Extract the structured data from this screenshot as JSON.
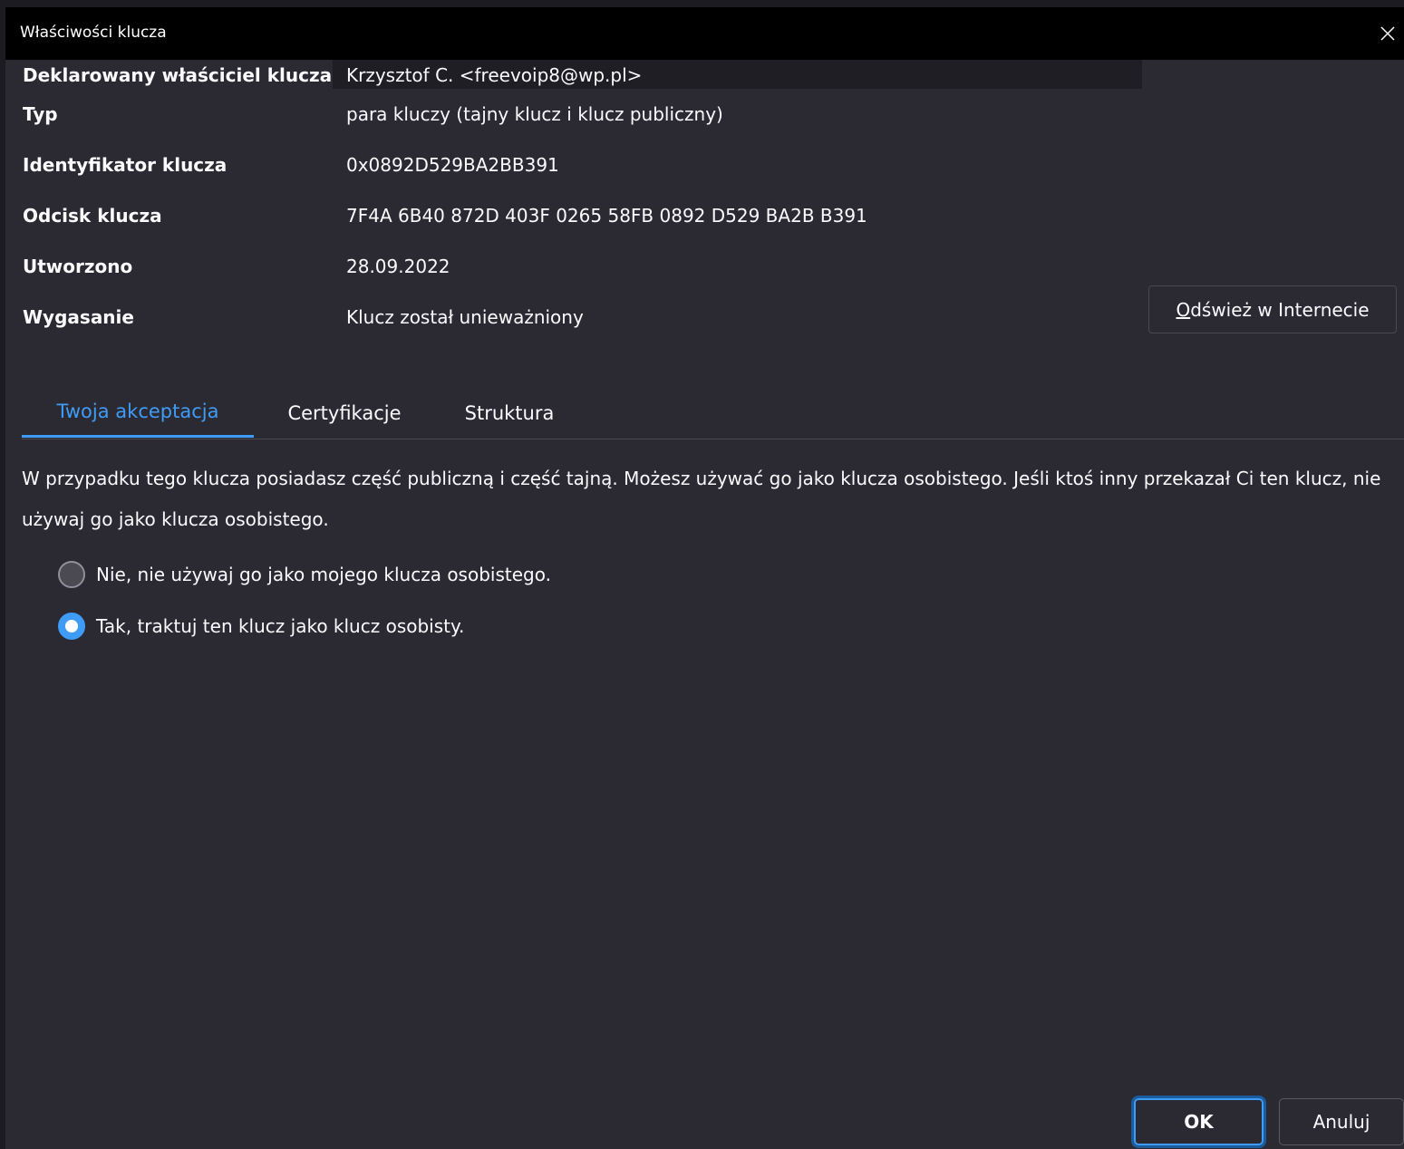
{
  "window": {
    "title": "Właściwości klucza"
  },
  "properties": [
    {
      "label": "Deklarowany właściciel klucza",
      "value": "Krzysztof C. <freevoip8@wp.pl>"
    },
    {
      "label": "Typ",
      "value": "para kluczy (tajny klucz i klucz publiczny)"
    },
    {
      "label": "Identyfikator klucza",
      "value": "0x0892D529BA2BB391"
    },
    {
      "label": "Odcisk klucza",
      "value": "7F4A 6B40 872D 403F 0265 58FB 0892 D529 BA2B B391"
    },
    {
      "label": "Utworzono",
      "value": "28.09.2022"
    },
    {
      "label": "Wygasanie",
      "value": "Klucz został unieważniony"
    }
  ],
  "refresh_button": {
    "access_key": "O",
    "rest": "dśwież w Internecie"
  },
  "tabs": [
    {
      "label": "Twoja akceptacja",
      "active": true
    },
    {
      "label": "Certyfikacje",
      "active": false
    },
    {
      "label": "Struktura",
      "active": false
    }
  ],
  "acceptance": {
    "description": "W przypadku tego klucza posiadasz część publiczną i część tajną. Możesz używać go jako klucza osobistego. Jeśli ktoś inny przekazał Ci ten klucz, nie używaj go jako klucza osobistego.",
    "options": [
      {
        "label": "Nie, nie używaj go jako mojego klucza osobistego.",
        "selected": false
      },
      {
        "label": "Tak, traktuj ten klucz jako klucz osobisty.",
        "selected": true
      }
    ]
  },
  "footer": {
    "ok_label": "OK",
    "cancel_label": "Anuluj"
  },
  "colors": {
    "accent": "#3f9cf6",
    "background": "#2b2a33",
    "titlebar": "#000000"
  }
}
